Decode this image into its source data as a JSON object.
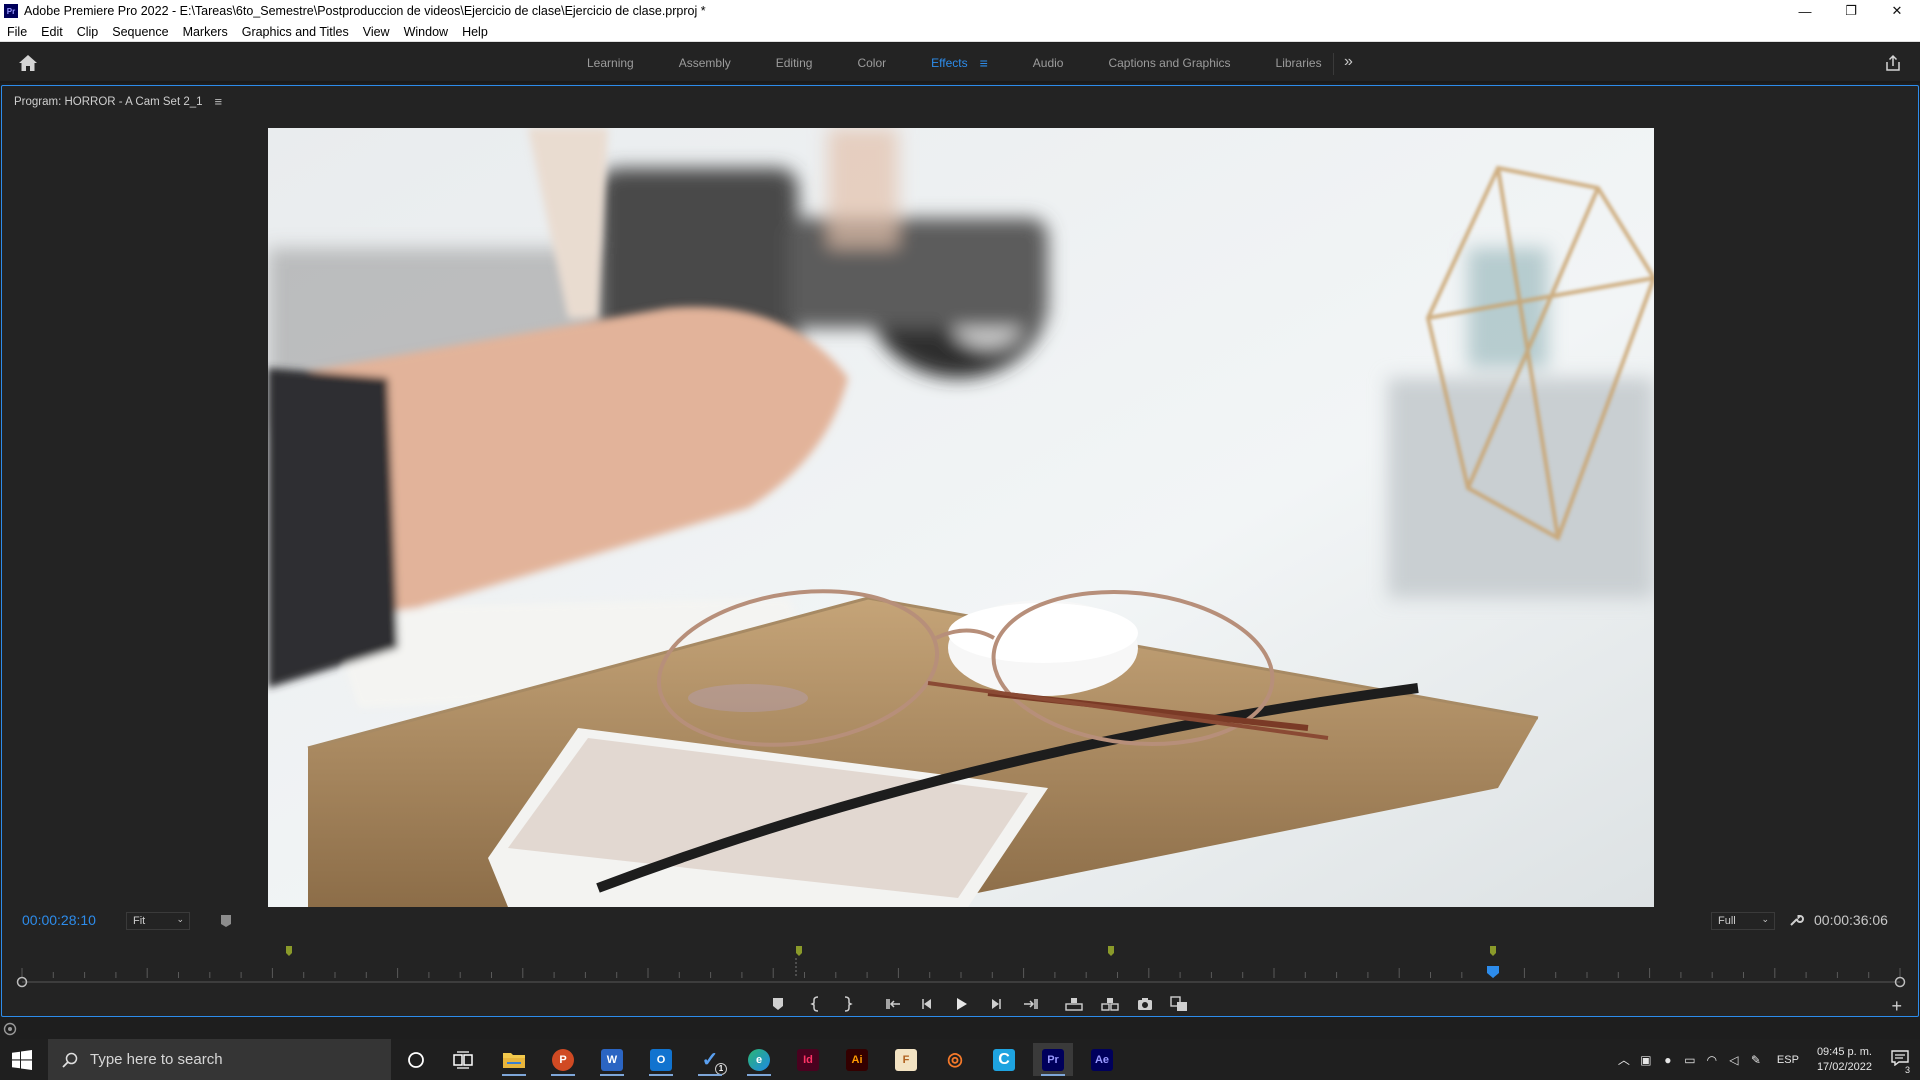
{
  "window": {
    "app_badge": "Pr",
    "title": "Adobe Premiere Pro 2022 - E:\\Tareas\\6to_Semestre\\Postproduccion de videos\\Ejercicio de clase\\Ejercicio de clase.prproj *",
    "minimize": "—",
    "maximize": "❐",
    "close": "✕"
  },
  "menu": [
    "File",
    "Edit",
    "Clip",
    "Sequence",
    "Markers",
    "Graphics and Titles",
    "View",
    "Window",
    "Help"
  ],
  "workspaces": {
    "tabs": [
      "Learning",
      "Assembly",
      "Editing",
      "Color",
      "Effects",
      "Audio",
      "Captions and Graphics",
      "Libraries"
    ],
    "active": "Effects",
    "more": "»"
  },
  "program_monitor": {
    "title": "Program: HORROR - A Cam Set 2_1",
    "menu_glyph": "≡",
    "playhead_timecode": "00:00:28:10",
    "zoom_level": "Fit",
    "playback_resolution": "Full",
    "duration_timecode": "00:00:36:06",
    "chevron": "⌄",
    "add": "+"
  },
  "colors": {
    "accent": "#2d8ceb",
    "panel_bg": "#232323",
    "marker_green": "#8a9a2a"
  },
  "taskbar": {
    "search_placeholder": "Type here to search",
    "apps": [
      {
        "name": "cortana",
        "label": "○"
      },
      {
        "name": "task-view",
        "label": "▯▯"
      },
      {
        "name": "file-explorer",
        "label": ""
      },
      {
        "name": "powerpoint",
        "label": "P"
      },
      {
        "name": "word",
        "label": "W"
      },
      {
        "name": "outlook",
        "label": "O"
      },
      {
        "name": "todo",
        "label": "✓"
      },
      {
        "name": "edge",
        "label": "e"
      },
      {
        "name": "indesign",
        "label": "Id"
      },
      {
        "name": "illustrator",
        "label": "Ai"
      },
      {
        "name": "fresco",
        "label": "F"
      },
      {
        "name": "blender",
        "label": "◎"
      },
      {
        "name": "ccleaner",
        "label": "C"
      },
      {
        "name": "premiere",
        "label": "Pr"
      },
      {
        "name": "after-effects",
        "label": "Ae"
      }
    ],
    "todo_badge": "1",
    "language": "ESP",
    "time": "09:45 p. m.",
    "date": "17/02/2022",
    "notifications": "3"
  }
}
